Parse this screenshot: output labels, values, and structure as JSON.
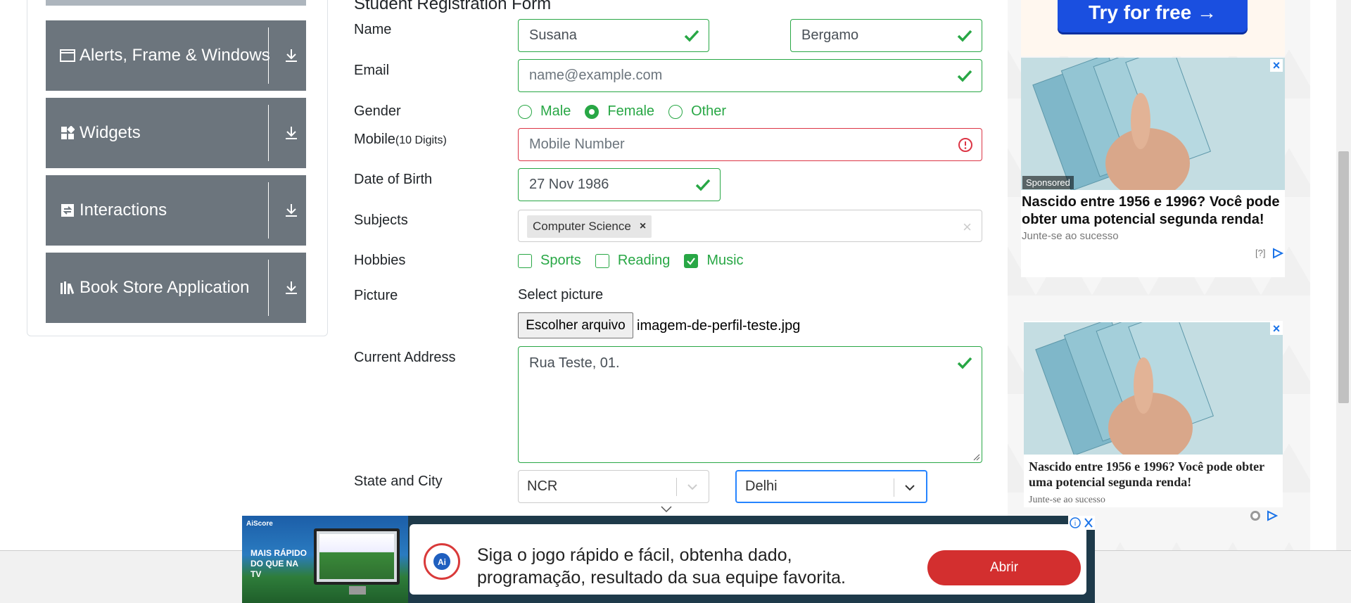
{
  "sidebar": {
    "items": [
      {
        "label": "Alerts, Frame & Windows",
        "icon": "window-icon"
      },
      {
        "label": "Widgets",
        "icon": "widgets-icon"
      },
      {
        "label": "Interactions",
        "icon": "interactions-icon"
      },
      {
        "label": "Book Store Application",
        "icon": "books-icon"
      }
    ]
  },
  "form": {
    "title": "Student Registration Form",
    "labels": {
      "name": "Name",
      "email": "Email",
      "gender": "Gender",
      "mobile": "Mobile",
      "mobile_hint": "(10 Digits)",
      "dob": "Date of Birth",
      "subjects": "Subjects",
      "hobbies": "Hobbies",
      "picture": "Picture",
      "address": "Current Address",
      "state_city": "State and City"
    },
    "first_name": "Susana",
    "last_name": "Bergamo",
    "email_placeholder": "name@example.com",
    "gender_options": [
      "Male",
      "Female",
      "Other"
    ],
    "gender_selected": "Female",
    "mobile_placeholder": "Mobile Number",
    "dob": "27 Nov 1986",
    "subject_chip": "Computer Science",
    "hobby_options": [
      "Sports",
      "Reading",
      "Music"
    ],
    "hobby_checked": [
      "Music"
    ],
    "picture_prompt": "Select picture",
    "file_button": "Escolher arquivo",
    "file_name": "imagem-de-perfil-teste.jpg",
    "address": "Rua Teste, 01.",
    "state": "NCR",
    "city": "Delhi"
  },
  "ads": {
    "try_button": "Try for free →",
    "sponsored": "Sponsored",
    "headline1": "Nascido entre 1956 e 1996? Você pode obter uma potencial segunda renda!",
    "source1": "Junte-se ao sucesso",
    "question": "[?]",
    "headline2": "Nascido entre 1956 e 1996? Você pode obter uma potencial segunda renda!",
    "source2": "Junte-se ao sucesso"
  },
  "banner": {
    "logo": "AiScore",
    "tagline": "MAIS RÁPIDO DO QUE NA TV",
    "text_line1": "Siga o jogo rápido e fácil, obtenha dado,",
    "text_line2": "programação, resultado da sua equipe favorita.",
    "button": "Abrir"
  },
  "colors": {
    "valid": "#28a745",
    "invalid": "#dc3545",
    "sidebar": "#6c757d",
    "focus": "#2684ff",
    "ad_button": "#1a4fe0",
    "banner_button": "#d32f2f"
  }
}
